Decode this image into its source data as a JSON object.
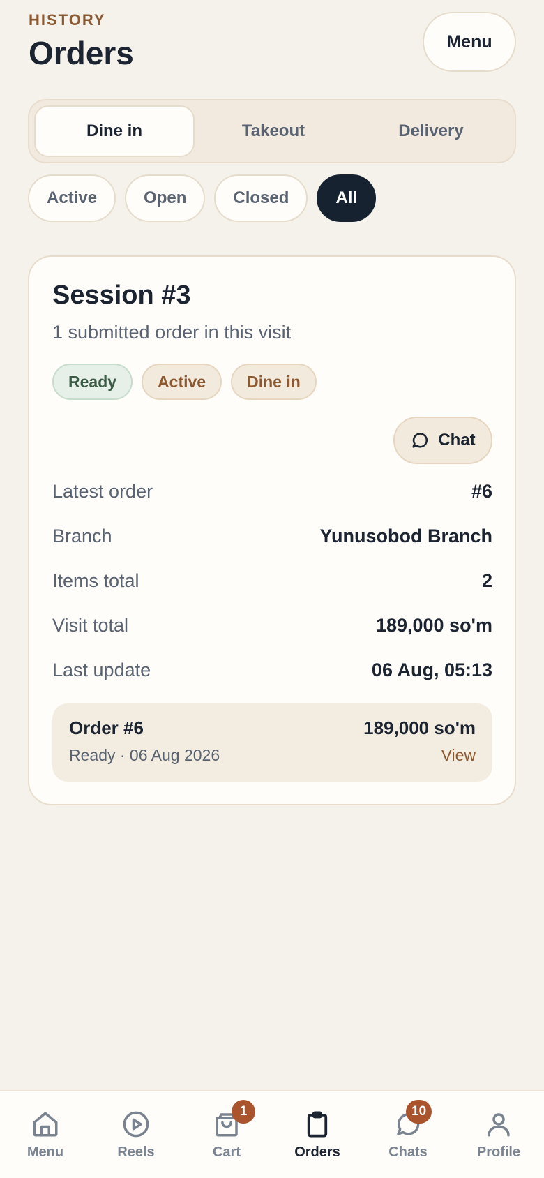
{
  "header": {
    "eyebrow": "HISTORY",
    "title": "Orders",
    "menu_button": "Menu"
  },
  "tabs": [
    {
      "label": "Dine in",
      "active": true
    },
    {
      "label": "Takeout",
      "active": false
    },
    {
      "label": "Delivery",
      "active": false
    }
  ],
  "filters": [
    {
      "label": "Active",
      "active": false
    },
    {
      "label": "Open",
      "active": false
    },
    {
      "label": "Closed",
      "active": false
    },
    {
      "label": "All",
      "active": true
    }
  ],
  "session": {
    "title": "Session #3",
    "subtitle": "1 submitted order in this visit",
    "badges": [
      "Ready",
      "Active",
      "Dine in"
    ],
    "chat_label": "Chat",
    "rows": [
      {
        "label": "Latest order",
        "value": "#6"
      },
      {
        "label": "Branch",
        "value": "Yunusobod Branch"
      },
      {
        "label": "Items total",
        "value": "2"
      },
      {
        "label": "Visit total",
        "value": "189,000 so'm"
      },
      {
        "label": "Last update",
        "value": "06 Aug, 05:13"
      }
    ],
    "order": {
      "title": "Order #6",
      "amount": "189,000 so'm",
      "meta": "Ready · 06 Aug 2026",
      "view_label": "View"
    }
  },
  "nav": [
    {
      "label": "Menu",
      "icon": "home-icon",
      "badge": ""
    },
    {
      "label": "Reels",
      "icon": "play-icon",
      "badge": ""
    },
    {
      "label": "Cart",
      "icon": "bag-icon",
      "badge": "1"
    },
    {
      "label": "Orders",
      "icon": "clipboard-icon",
      "badge": "",
      "active": true
    },
    {
      "label": "Chats",
      "icon": "chat-bubble-icon",
      "badge": "10"
    },
    {
      "label": "Profile",
      "icon": "person-icon",
      "badge": ""
    }
  ],
  "colors": {
    "background": "#f5f1eb",
    "accent": "#8c5a32",
    "dark": "#162230",
    "badge": "#a9542d",
    "ready_bg": "#e6f0e8"
  }
}
